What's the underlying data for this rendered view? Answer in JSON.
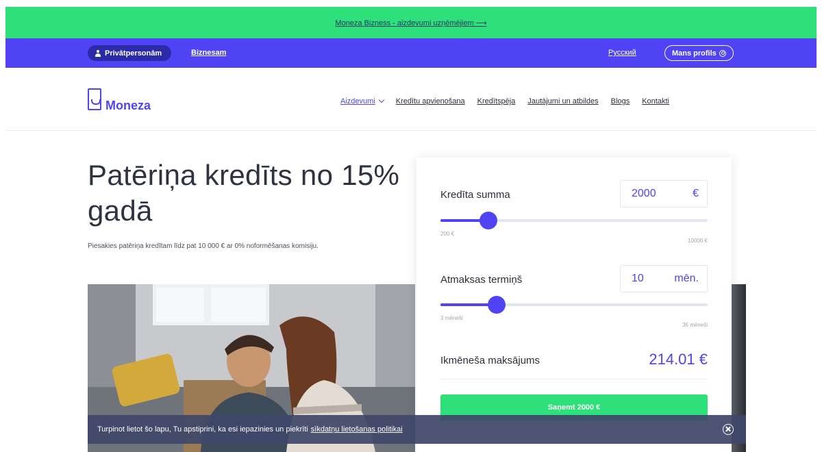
{
  "promo": {
    "link_text": "Moneza Bizness - aizdevumi uzņēmējiem ⟶"
  },
  "segment_bar": {
    "private_label": "Privātpersonām",
    "business_label": "Biznesam",
    "language_label": "Русский",
    "profile_label": "Mans profils"
  },
  "header": {
    "logo_text": "Moneza",
    "nav": [
      {
        "label": "Aizdevumi"
      },
      {
        "label": "Kredītu apvienošana"
      },
      {
        "label": "Kredītspēja"
      },
      {
        "label": "Jautājumi un atbildes"
      },
      {
        "label": "Blogs"
      },
      {
        "label": "Kontakti"
      }
    ]
  },
  "hero": {
    "title": "Patēriņa kredīts no 15% gadā",
    "subtitle": "Piesakies patēriņa kredītam līdz pat 10 000 € ar 0% noformēšanas komisiju."
  },
  "calculator": {
    "amount": {
      "label": "Kredīta summa",
      "value": "2000",
      "unit": "€",
      "min_label": "200 €",
      "max_label": "10000 €",
      "level": 0.18
    },
    "term": {
      "label": "Atmaksas termiņš",
      "value": "10",
      "unit": "mēn.",
      "min_label": "3 mēneši",
      "max_label": "36 mēneši",
      "level": 0.21
    },
    "payment": {
      "label": "Ikmēneša maksājums",
      "value": "214.01 €"
    },
    "cta_label": "Saņemt 2000 €"
  },
  "cookie": {
    "text": "Turpinot lietot šo lapu, Tu apstiprini, ka esi iepazinies un piekrīti",
    "link_text": "sīkdatņu lietošanas politikai"
  },
  "colors": {
    "brand": "#4f43f3",
    "accent_green": "#2ee07a",
    "cookie_bg": "#3f4768"
  }
}
